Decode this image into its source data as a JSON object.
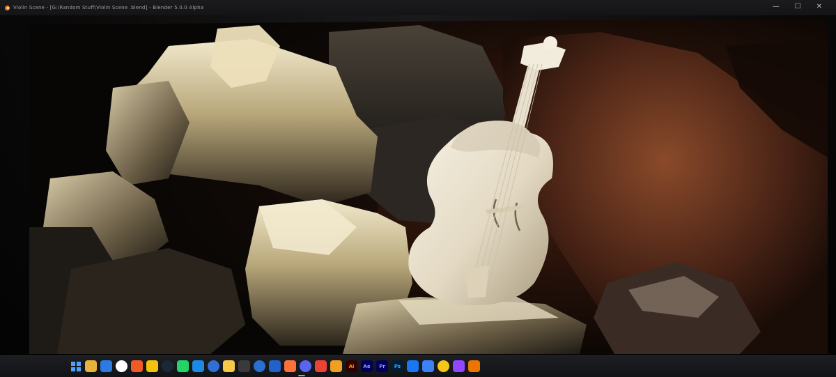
{
  "window": {
    "title": "Violin Scene - [G:\\Random Stuff\\Violin Scene .blend] - Blender 5.0.0 Alpha",
    "controls": [
      "—",
      "☐",
      "✕"
    ]
  },
  "taskbar": {
    "icons": [
      {
        "name": "windows-start-icon",
        "label": "",
        "color": "#4aa3ff"
      },
      {
        "name": "file-explorer-small-icon",
        "label": "",
        "color": "#e8b33c"
      },
      {
        "name": "calendar-icon",
        "label": "",
        "color": "#2d7be0"
      },
      {
        "name": "app-icon-5",
        "label": "",
        "color": "#ffffff"
      },
      {
        "name": "brave-icon",
        "label": "",
        "color": "#f05a28"
      },
      {
        "name": "chrome-icon",
        "label": "",
        "color": "#f4c20d"
      },
      {
        "name": "steam-icon",
        "label": "",
        "color": "#1b2838"
      },
      {
        "name": "whatsapp-icon",
        "label": "",
        "color": "#25d366"
      },
      {
        "name": "microsoft-store-icon",
        "label": "",
        "color": "#1e88e5"
      },
      {
        "name": "mail-icon",
        "label": "",
        "color": "#2f6fd6"
      },
      {
        "name": "file-explorer-icon",
        "label": "",
        "color": "#f7c948"
      },
      {
        "name": "terminal-icon",
        "label": "",
        "color": "#3a3a3a"
      },
      {
        "name": "unity-icon",
        "label": "",
        "color": "#2a6fd1"
      },
      {
        "name": "folder-icon",
        "label": "",
        "color": "#2062c9"
      },
      {
        "name": "firefox-icon",
        "label": "",
        "color": "#ff7139"
      },
      {
        "name": "discord-icon",
        "label": "",
        "color": "#5865f2"
      },
      {
        "name": "chrome-dev-icon",
        "label": "",
        "color": "#ea4335"
      },
      {
        "name": "search-icon",
        "label": "",
        "color": "#f0a020"
      },
      {
        "name": "illustrator-icon",
        "label": "Ai",
        "color": "#330000"
      },
      {
        "name": "after-effects-icon",
        "label": "Ae",
        "color": "#00005b"
      },
      {
        "name": "premiere-icon",
        "label": "Pr",
        "color": "#00005b"
      },
      {
        "name": "photoshop-icon",
        "label": "Ps",
        "color": "#001e36"
      },
      {
        "name": "messenger-icon",
        "label": "",
        "color": "#1877f2"
      },
      {
        "name": "phone-link-icon",
        "label": "",
        "color": "#3b82f6"
      },
      {
        "name": "app-icon-25",
        "label": "",
        "color": "#f5c518"
      },
      {
        "name": "twitch-icon",
        "label": "",
        "color": "#9146ff"
      },
      {
        "name": "blender-icon",
        "label": "",
        "color": "#ea7600"
      }
    ]
  }
}
